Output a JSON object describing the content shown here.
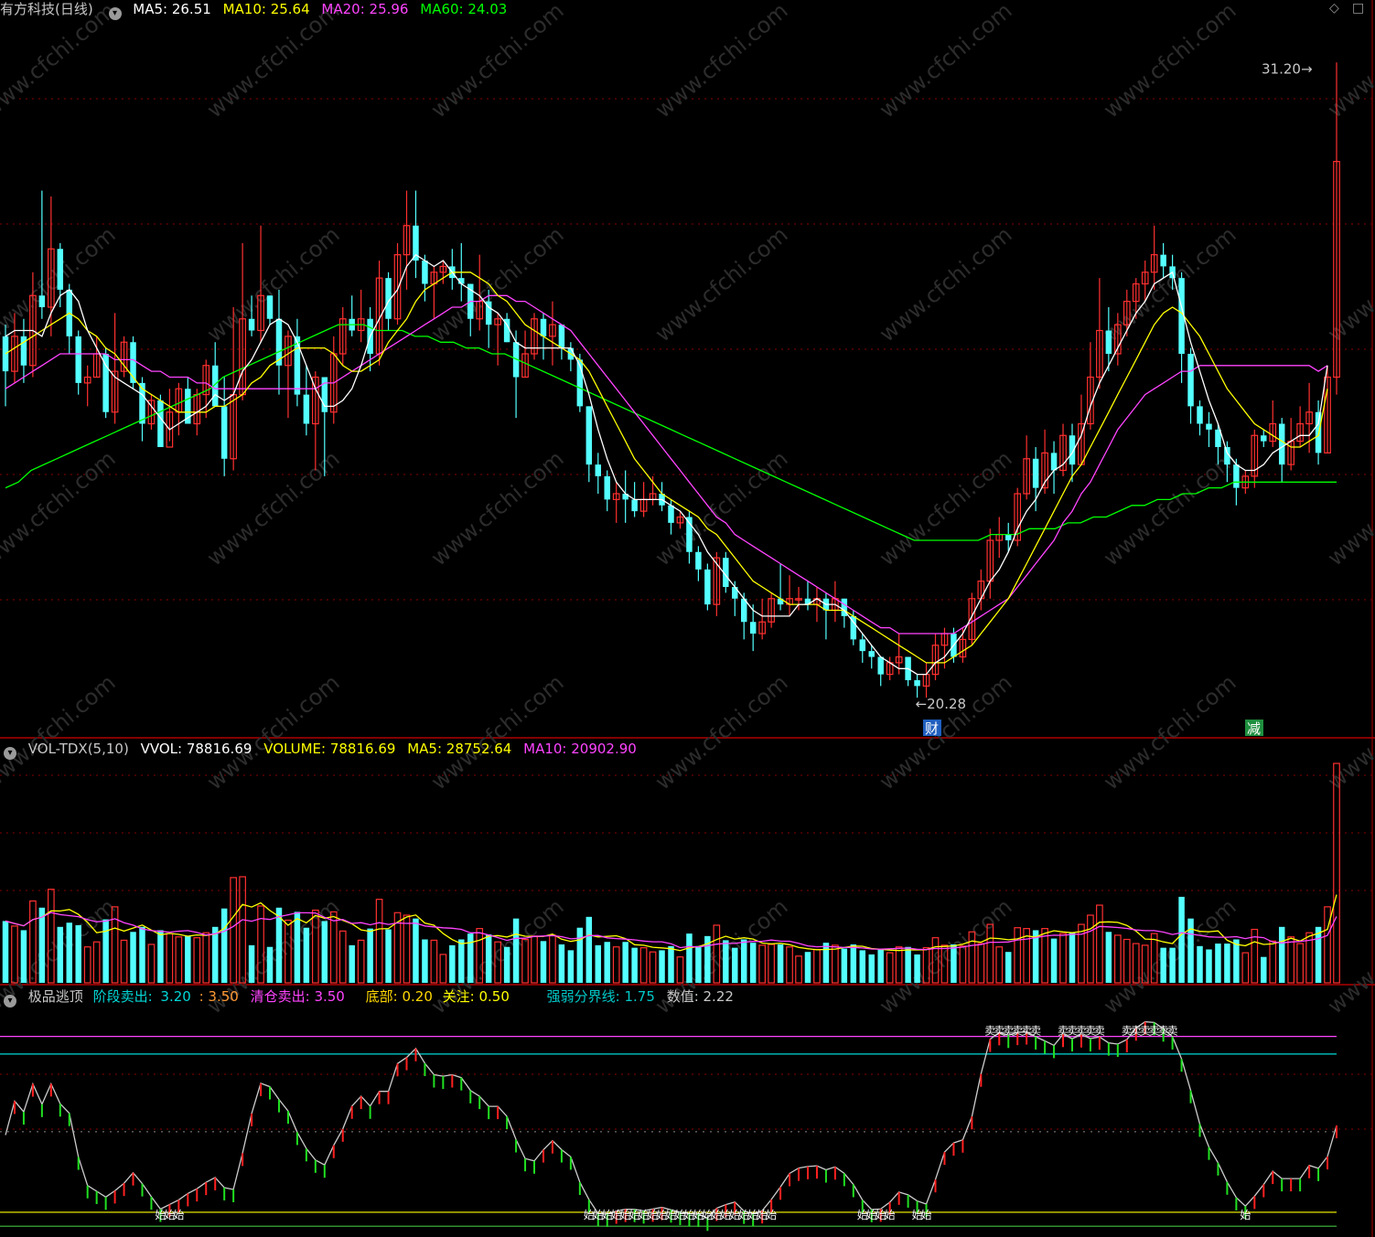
{
  "header": {
    "stock_title": "有方科技(日线)",
    "ma": [
      {
        "label": "MA5: 26.51",
        "color": "#ffffff"
      },
      {
        "label": "MA10: 25.64",
        "color": "#ffff00"
      },
      {
        "label": "MA20: 25.96",
        "color": "#ff44ff"
      },
      {
        "label": "MA60: 24.03",
        "color": "#00ff00"
      }
    ]
  },
  "volume_header": {
    "name": "VOL-TDX(5,10)",
    "vvol": "VVOL: 78816.69",
    "volume": "VOLUME: 78816.69",
    "ma5": "MA5: 28752.64",
    "ma10": "MA10: 20902.90"
  },
  "indicator_header": {
    "name": "极品逃顶",
    "stage_sell_label": "阶段卖出:",
    "stage_sell_value": "3.20",
    "stage_sell_value2": ": 3.50",
    "clear_sell": "清仓卖出: 3.50",
    "bottom": "底部: 0.20",
    "focus": "关注: 0.50",
    "divider": "强弱分界线: 1.75",
    "value": "数值: 2.22"
  },
  "annotations": {
    "high": "31.20",
    "low": "20.28",
    "tag_cai": "财",
    "tag_jian": "减",
    "bottom_mark": "始",
    "top_mark": "卖"
  },
  "watermark": "www.cfchi.com",
  "colors": {
    "up": "#ff3030",
    "down": "#54ffff",
    "ma5": "#ffffff",
    "ma10": "#ffff00",
    "ma20": "#ff44ff",
    "ma60": "#00ff00",
    "grid": "#880000"
  },
  "chart_data": {
    "type": "candlestick",
    "price_range": [
      19.8,
      31.8
    ],
    "candles": [
      [
        26.5,
        25.9,
        26.7,
        25.3
      ],
      [
        25.9,
        26.5,
        26.9,
        25.7
      ],
      [
        26.5,
        26.0,
        26.8,
        25.7
      ],
      [
        26.0,
        27.2,
        27.6,
        25.8
      ],
      [
        27.2,
        27.0,
        29.0,
        26.8
      ],
      [
        27.0,
        28.0,
        28.9,
        26.5
      ],
      [
        28.0,
        27.3,
        28.1,
        27.0
      ],
      [
        27.3,
        26.5,
        27.4,
        26.2
      ],
      [
        26.5,
        25.7,
        26.6,
        25.5
      ],
      [
        25.7,
        25.8,
        26.0,
        25.3
      ],
      [
        25.8,
        26.2,
        26.5,
        25.8
      ],
      [
        26.2,
        25.2,
        26.3,
        25.1
      ],
      [
        25.2,
        25.9,
        26.9,
        25.0
      ],
      [
        25.9,
        26.4,
        26.5,
        25.8
      ],
      [
        26.4,
        25.7,
        26.5,
        25.6
      ],
      [
        25.7,
        25.0,
        25.8,
        24.7
      ],
      [
        25.0,
        25.4,
        25.5,
        24.9
      ],
      [
        25.4,
        24.6,
        25.5,
        24.6
      ],
      [
        24.6,
        25.2,
        25.6,
        24.7
      ],
      [
        25.2,
        25.6,
        25.7,
        24.8
      ],
      [
        25.6,
        25.0,
        25.8,
        25.0
      ],
      [
        25.0,
        25.5,
        25.6,
        24.8
      ],
      [
        25.5,
        26.0,
        26.1,
        25.1
      ],
      [
        26.0,
        25.3,
        26.4,
        25.3
      ],
      [
        25.3,
        24.4,
        25.8,
        24.1
      ],
      [
        24.4,
        25.5,
        27.0,
        24.2
      ],
      [
        25.5,
        26.8,
        28.1,
        25.4
      ],
      [
        26.8,
        26.6,
        27.2,
        26.5
      ],
      [
        26.6,
        27.2,
        28.4,
        26.4
      ],
      [
        27.2,
        26.8,
        27.2,
        26.7
      ],
      [
        26.8,
        26.0,
        27.3,
        25.5
      ],
      [
        26.0,
        26.5,
        26.6,
        25.1
      ],
      [
        26.5,
        25.5,
        26.8,
        25.3
      ],
      [
        25.5,
        25.0,
        26.0,
        24.8
      ],
      [
        25.0,
        25.8,
        25.9,
        24.2
      ],
      [
        25.8,
        25.2,
        25.5,
        24.1
      ],
      [
        25.2,
        26.2,
        26.5,
        25.0
      ],
      [
        26.2,
        26.8,
        27.0,
        26.0
      ],
      [
        26.8,
        26.6,
        27.2,
        26.5
      ],
      [
        26.6,
        26.8,
        27.3,
        26.4
      ],
      [
        26.8,
        26.2,
        27.0,
        25.9
      ],
      [
        26.2,
        27.5,
        27.8,
        26.0
      ],
      [
        27.5,
        26.8,
        27.6,
        26.6
      ],
      [
        26.8,
        27.9,
        28.1,
        26.7
      ],
      [
        27.9,
        28.4,
        29.0,
        27.3
      ],
      [
        28.4,
        27.8,
        29.0,
        27.5
      ],
      [
        27.8,
        27.4,
        27.9,
        27.1
      ],
      [
        27.4,
        27.6,
        27.7,
        26.8
      ],
      [
        27.6,
        27.7,
        27.8,
        27.4
      ],
      [
        27.7,
        27.5,
        28.0,
        27.3
      ],
      [
        27.5,
        27.4,
        28.1,
        27.1
      ],
      [
        27.4,
        26.8,
        27.4,
        26.5
      ],
      [
        26.8,
        27.1,
        27.9,
        26.6
      ],
      [
        27.1,
        26.7,
        27.3,
        26.3
      ],
      [
        26.7,
        26.8,
        26.9,
        26.0
      ],
      [
        26.8,
        26.4,
        26.9,
        26.4
      ],
      [
        26.4,
        25.8,
        26.6,
        25.1
      ],
      [
        25.8,
        26.2,
        26.6,
        25.8
      ],
      [
        26.2,
        26.8,
        26.9,
        26.1
      ],
      [
        26.8,
        26.5,
        26.9,
        26.1
      ],
      [
        26.5,
        26.7,
        27.1,
        26.0
      ],
      [
        26.7,
        26.3,
        26.7,
        26.1
      ],
      [
        26.3,
        26.1,
        26.4,
        25.9
      ],
      [
        26.1,
        25.3,
        26.2,
        25.2
      ],
      [
        25.3,
        24.3,
        25.3,
        24.0
      ],
      [
        24.3,
        24.1,
        24.5,
        23.8
      ],
      [
        24.1,
        23.7,
        24.2,
        23.5
      ],
      [
        23.7,
        23.8,
        24.0,
        23.3
      ],
      [
        23.8,
        23.7,
        24.2,
        23.3
      ],
      [
        23.7,
        23.5,
        24.0,
        23.4
      ],
      [
        23.5,
        23.7,
        24.0,
        23.4
      ],
      [
        23.7,
        23.8,
        24.1,
        23.6
      ],
      [
        23.8,
        23.6,
        24.0,
        23.5
      ],
      [
        23.6,
        23.3,
        23.7,
        23.1
      ],
      [
        23.3,
        23.4,
        23.5,
        23.2
      ],
      [
        23.4,
        22.8,
        23.5,
        22.6
      ],
      [
        22.8,
        22.5,
        22.9,
        22.3
      ],
      [
        22.5,
        21.9,
        22.6,
        21.8
      ],
      [
        21.9,
        22.7,
        22.8,
        21.7
      ],
      [
        22.7,
        22.2,
        22.8,
        22.1
      ],
      [
        22.2,
        22.0,
        22.3,
        21.7
      ],
      [
        22.0,
        21.6,
        22.1,
        21.3
      ],
      [
        21.6,
        21.4,
        21.9,
        21.1
      ],
      [
        21.4,
        21.6,
        22.0,
        21.3
      ],
      [
        21.6,
        22.0,
        22.1,
        21.5
      ],
      [
        22.0,
        21.9,
        22.6,
        21.8
      ],
      [
        21.9,
        22.0,
        22.4,
        21.7
      ],
      [
        22.0,
        22.0,
        22.2,
        21.8
      ],
      [
        22.0,
        21.9,
        22.3,
        21.8
      ],
      [
        21.9,
        22.0,
        22.2,
        21.6
      ],
      [
        22.0,
        21.8,
        22.1,
        21.3
      ],
      [
        21.8,
        22.0,
        22.3,
        21.6
      ],
      [
        22.0,
        21.7,
        22.0,
        21.5
      ],
      [
        21.7,
        21.3,
        21.8,
        21.2
      ],
      [
        21.3,
        21.1,
        21.4,
        20.9
      ],
      [
        21.1,
        21.0,
        21.2,
        20.8
      ],
      [
        21.0,
        20.7,
        21.0,
        20.5
      ],
      [
        20.7,
        20.9,
        21.0,
        20.6
      ],
      [
        20.9,
        21.0,
        21.4,
        20.7
      ],
      [
        21.0,
        20.6,
        21.0,
        20.5
      ],
      [
        20.6,
        20.5,
        20.7,
        20.3
      ],
      [
        20.5,
        20.7,
        20.9,
        20.3
      ],
      [
        20.7,
        21.2,
        21.4,
        20.6
      ],
      [
        21.2,
        21.4,
        21.5,
        20.8
      ],
      [
        21.4,
        21.0,
        21.5,
        20.9
      ],
      [
        21.0,
        21.3,
        21.5,
        20.9
      ],
      [
        21.3,
        22.0,
        22.1,
        21.2
      ],
      [
        22.0,
        22.3,
        22.5,
        21.8
      ],
      [
        22.3,
        23.0,
        23.2,
        22.0
      ],
      [
        23.0,
        23.1,
        23.4,
        22.7
      ],
      [
        23.1,
        23.0,
        23.3,
        22.8
      ],
      [
        23.0,
        23.8,
        23.9,
        22.9
      ],
      [
        23.8,
        24.4,
        24.8,
        23.7
      ],
      [
        24.4,
        23.9,
        24.6,
        23.5
      ],
      [
        23.9,
        24.5,
        24.9,
        23.8
      ],
      [
        24.5,
        24.2,
        24.7,
        23.8
      ],
      [
        24.2,
        24.8,
        25.0,
        24.1
      ],
      [
        24.8,
        24.3,
        25.0,
        24.0
      ],
      [
        24.3,
        25.0,
        25.5,
        24.3
      ],
      [
        25.0,
        25.8,
        26.4,
        24.9
      ],
      [
        25.8,
        26.6,
        27.5,
        25.6
      ],
      [
        26.6,
        26.2,
        27.0,
        25.9
      ],
      [
        26.2,
        26.7,
        26.9,
        26.0
      ],
      [
        26.7,
        27.1,
        27.3,
        26.5
      ],
      [
        27.1,
        27.4,
        27.5,
        26.8
      ],
      [
        27.4,
        27.6,
        27.8,
        27.1
      ],
      [
        27.6,
        27.9,
        28.4,
        27.3
      ],
      [
        27.9,
        27.7,
        28.1,
        27.5
      ],
      [
        27.7,
        27.5,
        27.9,
        27.3
      ],
      [
        27.5,
        26.2,
        27.6,
        25.7
      ],
      [
        26.2,
        25.3,
        26.3,
        25.0
      ],
      [
        25.3,
        25.0,
        25.4,
        24.8
      ],
      [
        25.0,
        24.9,
        25.2,
        24.6
      ],
      [
        24.9,
        24.6,
        25.0,
        24.3
      ],
      [
        24.6,
        24.3,
        24.7,
        24.0
      ],
      [
        24.3,
        23.9,
        24.4,
        23.6
      ],
      [
        23.9,
        24.1,
        24.2,
        23.8
      ],
      [
        24.1,
        24.8,
        24.9,
        23.9
      ],
      [
        24.8,
        24.7,
        24.9,
        24.6
      ],
      [
        24.7,
        25.0,
        25.4,
        24.6
      ],
      [
        25.0,
        24.3,
        25.1,
        24.0
      ],
      [
        24.3,
        24.7,
        25.1,
        24.2
      ],
      [
        24.7,
        25.0,
        25.3,
        24.6
      ],
      [
        25.0,
        25.2,
        25.7,
        24.5
      ],
      [
        25.2,
        24.5,
        25.4,
        24.3
      ],
      [
        24.5,
        25.8,
        26.0,
        24.5
      ],
      [
        25.8,
        29.5,
        31.2,
        25.5
      ]
    ],
    "ma5": [
      26.5,
      26.6,
      26.6,
      26.6,
      26.5,
      26.9,
      27.2,
      27.3,
      27.1,
      26.6,
      26.3,
      26.0,
      25.8,
      25.7,
      25.6,
      25.5,
      25.3,
      25.1,
      24.9,
      25.0,
      25.1,
      25.2,
      25.3,
      25.5,
      25.4,
      25.5,
      25.9,
      26.1,
      26.4,
      26.7,
      26.8,
      26.7,
      26.4,
      26.0,
      25.6,
      25.3,
      25.3,
      25.4,
      25.6,
      26.0,
      26.5,
      26.8,
      27.1,
      27.3,
      27.7,
      27.9,
      27.8,
      27.7,
      27.8,
      27.6,
      27.4,
      27.3,
      27.2,
      27.0,
      26.9,
      26.7,
      26.4,
      26.3,
      26.3,
      26.3,
      26.3,
      26.3,
      26.3,
      26.0,
      25.5,
      24.9,
      24.4,
      24.0,
      23.8,
      23.7,
      23.7,
      23.7,
      23.7,
      23.6,
      23.5,
      23.3,
      23.1,
      22.8,
      22.6,
      22.4,
      22.2,
      22.0,
      21.8,
      21.7,
      21.7,
      21.7,
      21.7,
      21.9,
      21.9,
      22.0,
      21.9,
      21.9,
      21.8,
      21.6,
      21.4,
      21.2,
      21.0,
      20.9,
      20.8,
      20.8,
      20.7,
      20.7,
      20.9,
      21.0,
      21.2,
      21.4,
      21.7,
      22.0,
      22.3,
      22.5,
      22.8,
      23.2,
      23.5,
      23.7,
      24.0,
      24.2,
      24.3,
      24.5,
      24.8,
      25.3,
      25.7,
      26.0,
      26.3,
      26.6,
      26.9,
      27.1,
      27.4,
      27.5,
      27.6,
      27.0,
      26.4,
      25.9,
      25.4,
      25.0,
      24.5,
      24.3,
      24.2,
      24.2,
      24.3,
      24.5,
      24.6,
      24.7,
      24.8,
      24.8,
      25.0,
      26.0
    ],
    "ma10": [
      26.2,
      26.3,
      26.4,
      26.5,
      26.6,
      26.7,
      26.8,
      26.9,
      26.8,
      26.6,
      26.5,
      26.3,
      26.2,
      26.0,
      25.8,
      25.6,
      25.5,
      25.4,
      25.3,
      25.2,
      25.2,
      25.2,
      25.2,
      25.3,
      25.3,
      25.4,
      25.5,
      25.7,
      25.8,
      26.0,
      26.1,
      26.2,
      26.3,
      26.3,
      26.3,
      26.3,
      26.2,
      26.0,
      25.9,
      25.9,
      26.0,
      26.1,
      26.4,
      26.6,
      26.8,
      27.1,
      27.3,
      27.4,
      27.5,
      27.6,
      27.6,
      27.6,
      27.5,
      27.4,
      27.2,
      27.1,
      26.9,
      26.7,
      26.6,
      26.5,
      26.4,
      26.3,
      26.2,
      26.1,
      25.9,
      25.6,
      25.3,
      25.0,
      24.7,
      24.4,
      24.2,
      24.0,
      23.8,
      23.7,
      23.6,
      23.5,
      23.4,
      23.2,
      23.1,
      22.9,
      22.7,
      22.5,
      22.3,
      22.2,
      22.1,
      22.0,
      21.9,
      21.9,
      21.9,
      21.9,
      21.8,
      21.8,
      21.8,
      21.7,
      21.6,
      21.5,
      21.4,
      21.3,
      21.2,
      21.1,
      21.0,
      20.9,
      20.9,
      20.9,
      21.0,
      21.1,
      21.2,
      21.4,
      21.6,
      21.8,
      22.0,
      22.3,
      22.6,
      22.9,
      23.2,
      23.5,
      23.8,
      24.1,
      24.3,
      24.6,
      24.9,
      25.2,
      25.5,
      25.8,
      26.1,
      26.4,
      26.7,
      26.9,
      27.0,
      26.9,
      26.7,
      26.5,
      26.2,
      25.9,
      25.6,
      25.4,
      25.2,
      25.0,
      24.9,
      24.8,
      24.7,
      24.6,
      24.6,
      24.7,
      24.8,
      25.6
    ],
    "ma20": [
      25.6,
      25.7,
      25.8,
      25.9,
      26.0,
      26.1,
      26.2,
      26.2,
      26.2,
      26.2,
      26.2,
      26.2,
      26.1,
      26.1,
      26.1,
      26.0,
      25.9,
      25.9,
      25.8,
      25.8,
      25.8,
      25.7,
      25.7,
      25.6,
      25.6,
      25.6,
      25.6,
      25.6,
      25.6,
      25.6,
      25.6,
      25.6,
      25.6,
      25.6,
      25.6,
      25.7,
      25.7,
      25.8,
      25.9,
      26.0,
      26.1,
      26.2,
      26.3,
      26.4,
      26.5,
      26.6,
      26.7,
      26.8,
      26.9,
      27.0,
      27.0,
      27.1,
      27.1,
      27.2,
      27.2,
      27.2,
      27.1,
      27.1,
      27.0,
      26.9,
      26.8,
      26.7,
      26.6,
      26.4,
      26.2,
      26.0,
      25.8,
      25.6,
      25.4,
      25.2,
      25.0,
      24.8,
      24.6,
      24.4,
      24.2,
      24.0,
      23.8,
      23.6,
      23.4,
      23.3,
      23.1,
      23.0,
      22.9,
      22.8,
      22.7,
      22.6,
      22.5,
      22.4,
      22.3,
      22.2,
      22.1,
      22.0,
      21.9,
      21.8,
      21.7,
      21.6,
      21.5,
      21.5,
      21.4,
      21.4,
      21.4,
      21.4,
      21.4,
      21.4,
      21.4,
      21.5,
      21.6,
      21.7,
      21.8,
      21.9,
      22.0,
      22.2,
      22.4,
      22.6,
      22.8,
      23.0,
      23.3,
      23.5,
      23.8,
      24.0,
      24.3,
      24.6,
      24.9,
      25.1,
      25.3,
      25.5,
      25.6,
      25.7,
      25.8,
      25.9,
      25.9,
      26.0,
      26.0,
      26.0,
      26.0,
      26.0,
      26.0,
      26.0,
      26.0,
      26.0,
      26.0,
      26.0,
      26.0,
      26.0,
      25.9,
      26.0
    ],
    "ma60": [
      23.9,
      24.0,
      24.2,
      24.3,
      24.4,
      24.5,
      24.6,
      24.7,
      24.8,
      24.9,
      25.0,
      25.1,
      25.2,
      25.3,
      25.4,
      25.5,
      25.6,
      25.8,
      25.9,
      26.0,
      26.1,
      26.2,
      26.3,
      26.4,
      26.5,
      26.6,
      26.7,
      26.7,
      26.7,
      26.6,
      26.6,
      26.6,
      26.5,
      26.5,
      26.4,
      26.4,
      26.3,
      26.3,
      26.2,
      26.2,
      26.1,
      26.0,
      25.9,
      25.8,
      25.7,
      25.6,
      25.5,
      25.4,
      25.3,
      25.2,
      25.1,
      25.0,
      24.9,
      24.8,
      24.7,
      24.6,
      24.5,
      24.4,
      24.3,
      24.2,
      24.1,
      24.0,
      23.9,
      23.8,
      23.7,
      23.6,
      23.5,
      23.4,
      23.3,
      23.2,
      23.1,
      23.0,
      23.0,
      23.0,
      23.0,
      23.0,
      23.0,
      23.1,
      23.1,
      23.1,
      23.2,
      23.2,
      23.2,
      23.3,
      23.3,
      23.4,
      23.4,
      23.5,
      23.6,
      23.6,
      23.7,
      23.7,
      23.8,
      23.8,
      23.9,
      23.9,
      24.0,
      24.0,
      24.0,
      24.0,
      24.0,
      24.0,
      24.0,
      24.0,
      24.0
    ],
    "volume_max": 78816.69,
    "volume_mode_note_omit": null,
    "indicator_lines": {
      "stage_sell": 3.2,
      "stage_sell2": 3.5,
      "clear_sell": 3.5,
      "bottom": 0.2,
      "focus": 0.5,
      "divider": 1.75,
      "value": 2.22
    },
    "indicator_range": [
      0.0,
      3.9
    ]
  }
}
